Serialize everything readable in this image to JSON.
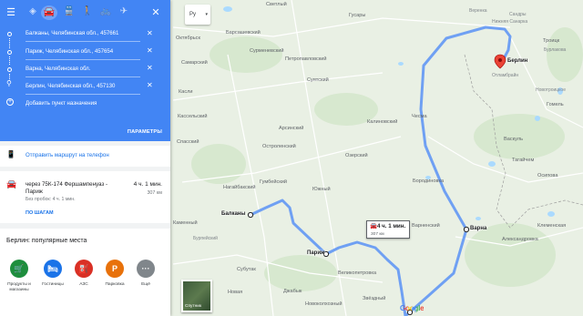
{
  "modes": {
    "menu_icon": "menu-icon",
    "items": [
      "best-route-icon",
      "car-icon",
      "transit-icon",
      "walk-icon",
      "bike-icon",
      "flight-icon"
    ],
    "active": "car-icon",
    "close_icon": "close-icon"
  },
  "stops": [
    {
      "label": "Балканы, Челябинская обл., 457661"
    },
    {
      "label": "Париж, Челябинская обл., 457654"
    },
    {
      "label": "Варна, Челябинская обл."
    },
    {
      "label": "Берлин, Челябинская обл., 457130"
    }
  ],
  "add_destination": "Добавить пункт назначения",
  "options_button": "ПАРАМЕТРЫ",
  "send_to_phone": "Отправить маршрут на телефон",
  "route": {
    "via": "через 75К-174 Фершампенуаз - Париж",
    "time": "4 ч. 1 мин.",
    "distance": "307 км",
    "traffic": "Без пробок: 4 ч. 1 мин.",
    "steps_link": "ПО ШАГАМ"
  },
  "popular": {
    "title": "Берлин: популярные места",
    "categories": [
      {
        "label": "Продукты и магазины",
        "icon": "cart-icon",
        "color": "#1e8e3e",
        "glyph": "🛒"
      },
      {
        "label": "Гостиницы",
        "icon": "hotel-icon",
        "color": "#1a73e8",
        "glyph": "🛏"
      },
      {
        "label": "АЗС",
        "icon": "gas-station-icon",
        "color": "#d93025",
        "glyph": "⛽"
      },
      {
        "label": "Парковка",
        "icon": "parking-icon",
        "color": "#e8710a",
        "glyph": "P"
      },
      {
        "label": "Ещё",
        "icon": "more-icon",
        "color": "#80868b",
        "glyph": "···"
      }
    ]
  },
  "tab_label": "Ру",
  "satellite_label": "Спутник",
  "google_logo": "Google",
  "route_bubble": {
    "time": "4 ч. 1 мин.",
    "distance": "307 км"
  },
  "map_labels": {
    "balkany": "Балканы",
    "parizh": "Париж",
    "varna": "Варна",
    "berlin": "Берлин"
  },
  "places": [
    "Светлый",
    "Гусары",
    "Веренка",
    "Сандры",
    "Нижняя Санарка",
    "Троицк",
    "Бурлакова",
    "Октябрьск",
    "Барсашевский",
    "Сурменевский",
    "Самарский",
    "Петропавловский",
    "Кассельский",
    "Арсинский",
    "Суятский",
    "Калиновский",
    "Чесма",
    "Отламбрайн",
    "Новотроицкое",
    "Гомель",
    "Касли",
    "Спасский",
    "Остроленский",
    "Озерский",
    "Бородиновка",
    "Васкуль",
    "Тагайчем",
    "Гумбейский",
    "Нагайбакский",
    "Южный",
    "Каменный",
    "Бурпейский",
    "Субутак",
    "Варненский",
    "Великопетровка",
    "Новоколхозный",
    "Джабык",
    "Александровка",
    "Клеменская",
    "Новая",
    "Звёздный",
    "Осипова"
  ],
  "colors": {
    "header": "#4285f4",
    "route": "#6fa0f3",
    "link": "#1a73e8"
  }
}
